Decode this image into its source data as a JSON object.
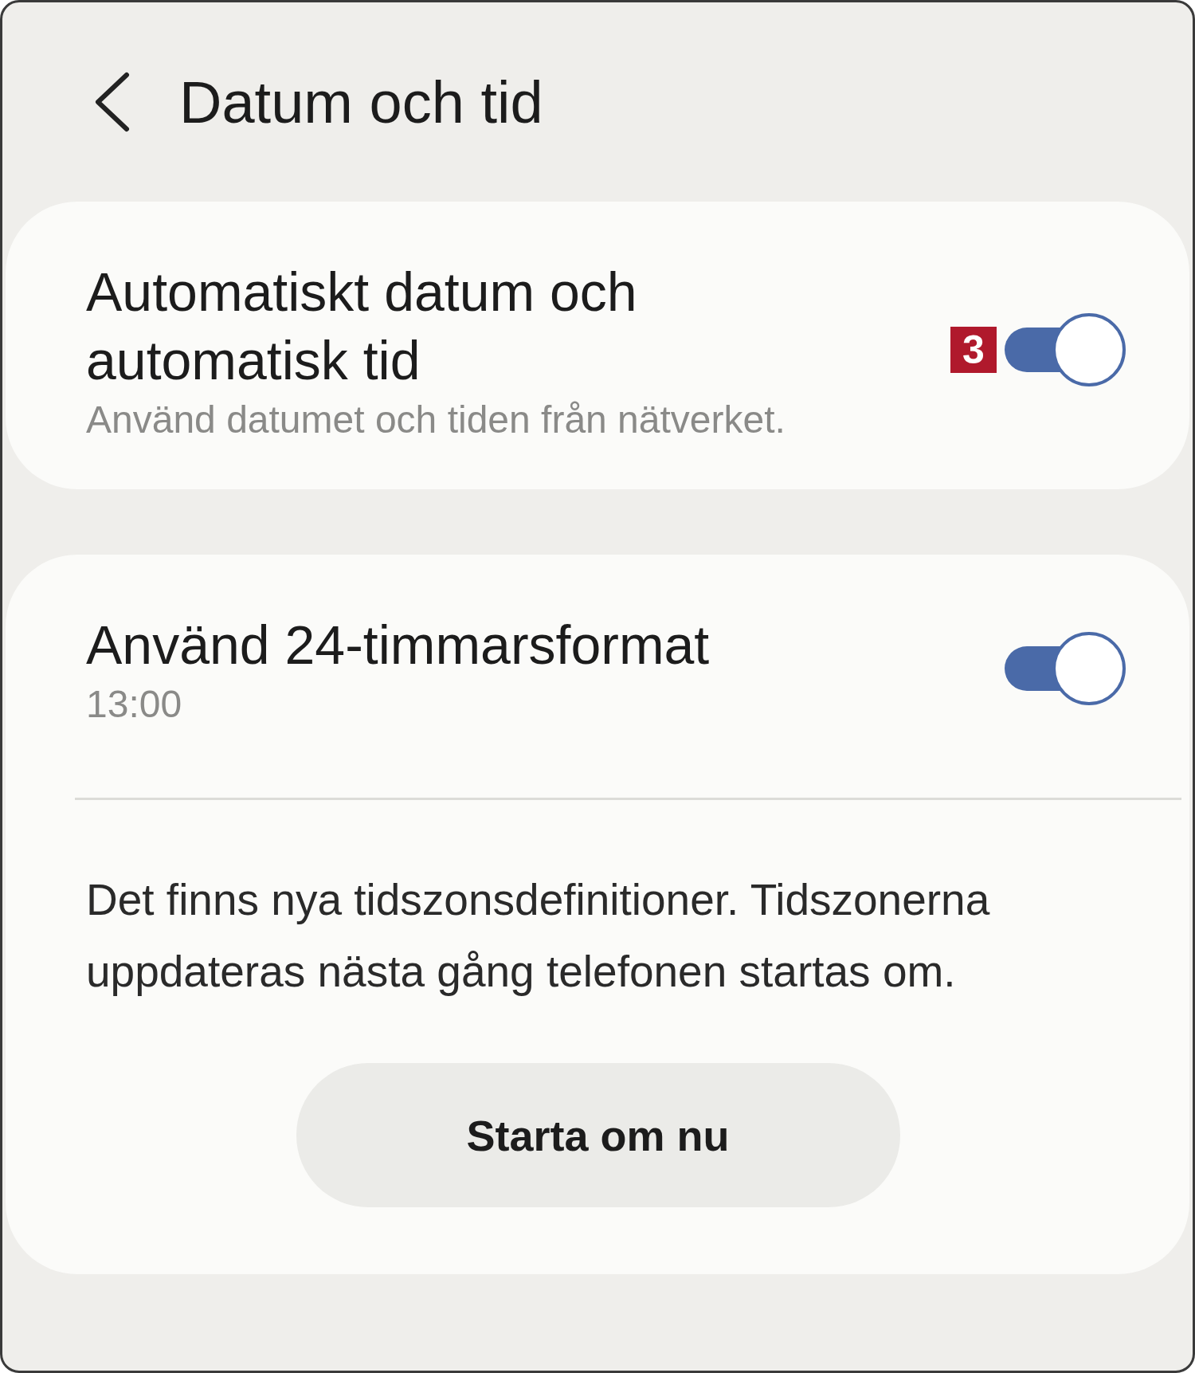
{
  "header": {
    "title": "Datum och tid"
  },
  "cards": [
    {
      "settings": [
        {
          "kind": "toggle",
          "title": "Automatiskt datum och automatisk tid",
          "subtitle": "Använd datumet och tiden från nätverket.",
          "badge": "3",
          "on": true
        }
      ]
    },
    {
      "settings": [
        {
          "kind": "toggle",
          "title": "Använd 24-timmarsformat",
          "subtitle": "13:00",
          "on": true
        }
      ],
      "notice": "Det finns nya tidszonsdefinitioner. Tidszonerna uppdateras nästa gång telefonen startas om.",
      "button": "Starta om nu"
    }
  ]
}
